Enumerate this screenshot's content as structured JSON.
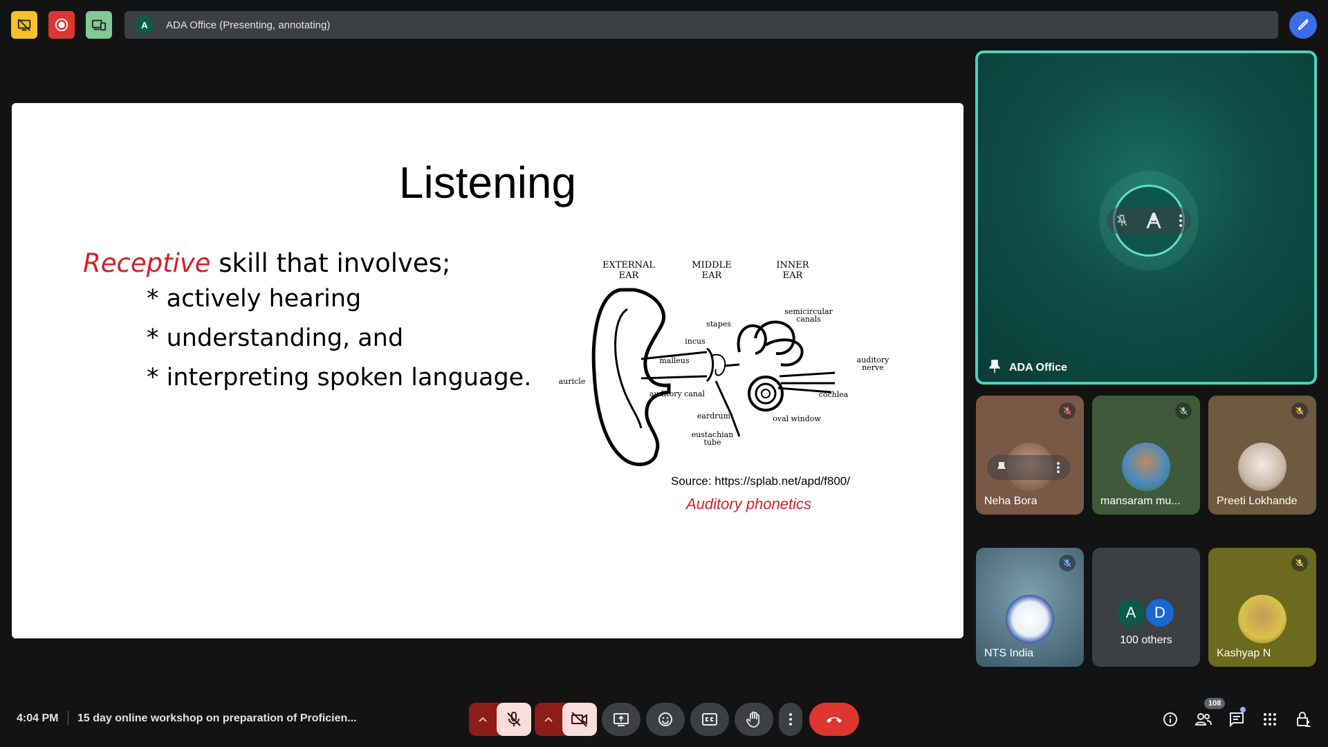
{
  "top_bar": {
    "presenter_initial": "A",
    "presenter_text": "ADA Office (Presenting, annotating)",
    "buttons": [
      "stop-presenting-icon",
      "recording-icon",
      "companion-icon",
      "annotate-icon"
    ]
  },
  "slide": {
    "title": "Listening",
    "lead_highlight": "Receptive",
    "lead_rest": " skill that involves;",
    "bullets": [
      "* actively hearing",
      "* understanding, and",
      "* interpreting spoken language."
    ],
    "diagram_labels": {
      "external_ear_1": "EXTERNAL",
      "external_ear_2": "EAR",
      "middle_ear_1": "MIDDLE",
      "middle_ear_2": "EAR",
      "inner_ear_1": "INNER",
      "inner_ear_2": "EAR",
      "semicircular_1": "semicircular",
      "semicircular_2": "canals",
      "stapes": "stapes",
      "incus": "incus",
      "malleus": "malleus",
      "auditory_nerve_1": "auditory",
      "auditory_nerve_2": "nerve",
      "auricle": "auricle",
      "auditory_canal": "auditory canal",
      "cochlea": "cochlea",
      "eardrum": "eardrum",
      "oval_window": "oval window",
      "eustachian_1": "eustachian",
      "eustachian_2": "tube"
    },
    "source": "Source: https://splab.net/apd/f800/",
    "caption": "Auditory phonetics"
  },
  "pinned_tile": {
    "name": "ADA Office",
    "initial": "A"
  },
  "tiles": [
    {
      "name": "Neha Bora",
      "bg": "#7a5846"
    },
    {
      "name": "mansaram mu...",
      "bg": "#3f5a3a"
    },
    {
      "name": "Preeti Lokhande",
      "bg": "#6e5a3e"
    },
    {
      "name": "NTS India",
      "bg": "#4b6e80"
    },
    {
      "name": "Kashyap N",
      "bg": "#6b6a1e"
    }
  ],
  "others": {
    "initial_a": "A",
    "initial_d": "D",
    "label": "100 others"
  },
  "bottom_bar": {
    "time": "4:04 PM",
    "meeting_title": "15 day online workshop on preparation of Proficien...",
    "participant_count": "108"
  },
  "colors": {
    "accent_teal": "#4ed0bd",
    "end_call": "#dc362e",
    "slide_red": "#d3202a"
  }
}
